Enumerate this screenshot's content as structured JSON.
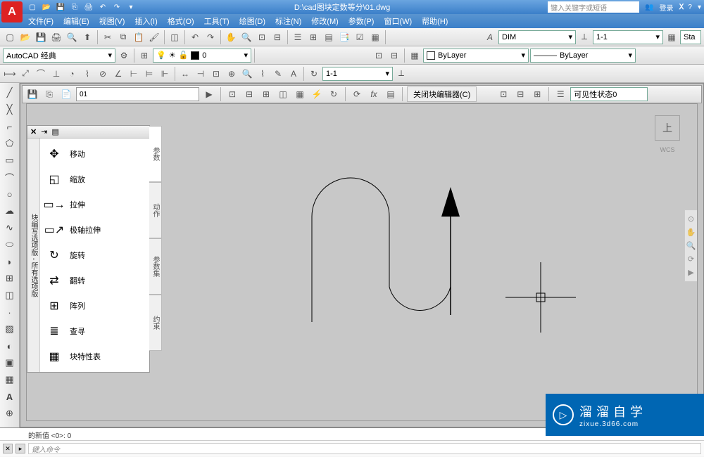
{
  "title": "D:\\cad图块定数等分\\01.dwg",
  "search_placeholder": "键入关键字或短语",
  "login": "登录",
  "menus": [
    "文件(F)",
    "编辑(E)",
    "视图(V)",
    "插入(I)",
    "格式(O)",
    "工具(T)",
    "绘图(D)",
    "标注(N)",
    "修改(M)",
    "参数(P)",
    "窗口(W)",
    "帮助(H)"
  ],
  "workspace": "AutoCAD 经典",
  "layer": {
    "name": "0",
    "color": "#000"
  },
  "text_style": "DIM",
  "dim_style": "1-1",
  "annoscale": "1-1",
  "bylayer": "ByLayer",
  "bylayer2": "ByLayer",
  "block_name": "01",
  "close_block": "关闭块编辑器(C)",
  "vis_state": "可见性状态0",
  "wcs": "WCS",
  "sta_btn": "Sta",
  "palette": {
    "vtitle": "块编写选项版 - 所有选项版",
    "items": [
      {
        "icon": "✥",
        "label": "移动"
      },
      {
        "icon": "◱",
        "label": "缩放"
      },
      {
        "icon": "▭→",
        "label": "拉伸"
      },
      {
        "icon": "▭↗",
        "label": "极轴拉伸"
      },
      {
        "icon": "↻",
        "label": "旋转"
      },
      {
        "icon": "⇄",
        "label": "翻转"
      },
      {
        "icon": "⊞",
        "label": "阵列"
      },
      {
        "icon": "≣",
        "label": "查寻"
      },
      {
        "icon": "▦",
        "label": "块特性表"
      }
    ],
    "tabs": [
      "参数",
      "动作",
      "参数集",
      "约束"
    ]
  },
  "cmd_history": "的新值 <0>: 0",
  "cmd_prompt": "键入命令",
  "watermark": {
    "name": "溜溜自学",
    "url": "zixue.3d66.com"
  }
}
